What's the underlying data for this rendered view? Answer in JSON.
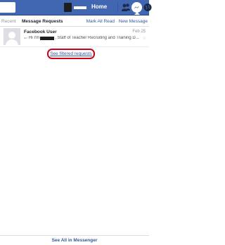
{
  "header": {
    "home_label": "Home",
    "colors": {
      "bar": "#4267b2",
      "accent": "#365899"
    },
    "icons": [
      "friend-requests-icon",
      "messenger-icon",
      "notifications-globe-icon"
    ]
  },
  "tabs": {
    "recent_label": "Recent",
    "requests_label": "Message Requests",
    "mark_all_read_label": "Mark All Read",
    "separator": " · ",
    "new_message_label": "New Message"
  },
  "thread": {
    "sender": "Facebook User",
    "date": "Feb 25",
    "snippet_start": "Hi I'm",
    "snippet_end": ", Staff of Teacher Recruiting and Training D...",
    "icons": [
      "reply-arrow-icon",
      "star-icon"
    ]
  },
  "filtered": {
    "label": "See filtered requests",
    "highlight_color": "#d0021b"
  },
  "footer": {
    "label": "See All in Messenger"
  }
}
